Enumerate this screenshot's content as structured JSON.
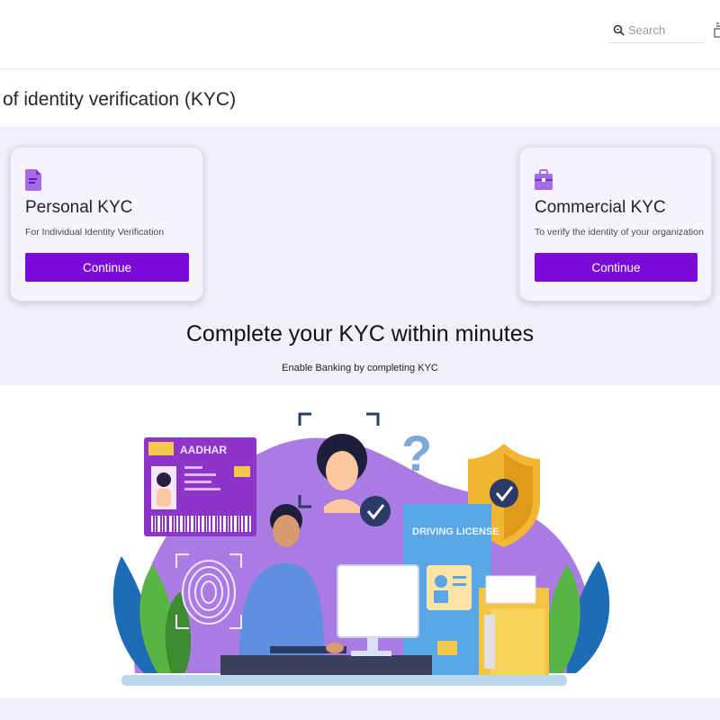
{
  "header": {
    "search_placeholder": "Search"
  },
  "page": {
    "title": "of identity verification (KYC)"
  },
  "cards": [
    {
      "icon": "document-icon",
      "title": "Personal KYC",
      "description": "For Individual Identity Verification",
      "button_label": "Continue"
    },
    {
      "icon": "briefcase-icon",
      "title": "Commercial KYC",
      "description": "To verify the identity of your organization",
      "button_label": "Continue"
    }
  ],
  "hero": {
    "headline": "Complete your KYC within minutes",
    "subline": "Enable Banking by completing KYC"
  },
  "illustration": {
    "aadhar_label": "AADHAR",
    "license_label": "DRIVING LICENSE"
  },
  "colors": {
    "primary_button": "#7b0ad9",
    "band_background": "#f1eff9",
    "illustration_purple": "#a97be3"
  }
}
